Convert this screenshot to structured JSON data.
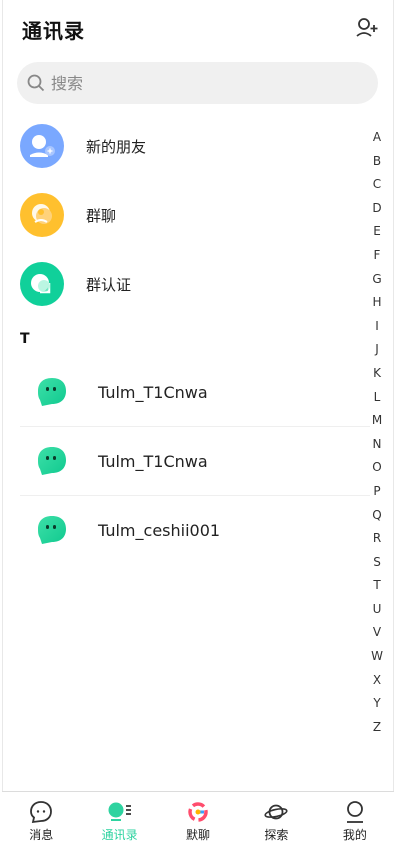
{
  "header": {
    "title": "通讯录",
    "add_icon": "add-friend-icon"
  },
  "search": {
    "placeholder": "搜索",
    "icon": "search-icon"
  },
  "entries": [
    {
      "label": "新的朋友",
      "color": "#7aa8ff",
      "icon": "new-friend-icon"
    },
    {
      "label": "群聊",
      "color": "#ffc02e",
      "icon": "group-chat-icon"
    },
    {
      "label": "群认证",
      "color": "#10d09a",
      "icon": "group-verify-icon"
    }
  ],
  "section": {
    "letter": "T"
  },
  "contacts": [
    {
      "name": "Tulm_T1Cnwa"
    },
    {
      "name": "Tulm_T1Cnwa"
    },
    {
      "name": "Tulm_ceshii001"
    }
  ],
  "index_letters": [
    "A",
    "B",
    "C",
    "D",
    "E",
    "F",
    "G",
    "H",
    "I",
    "J",
    "K",
    "L",
    "M",
    "N",
    "O",
    "P",
    "Q",
    "R",
    "S",
    "T",
    "U",
    "V",
    "W",
    "X",
    "Y",
    "Z"
  ],
  "tabs": [
    {
      "label": "消息",
      "icon": "message-icon"
    },
    {
      "label": "通讯录",
      "icon": "contacts-icon",
      "active": true
    },
    {
      "label": "默聊",
      "icon": "moliao-icon"
    },
    {
      "label": "探索",
      "icon": "planet-icon"
    },
    {
      "label": "我的",
      "icon": "profile-icon"
    }
  ],
  "colors": {
    "accent": "#2ed3a0"
  }
}
